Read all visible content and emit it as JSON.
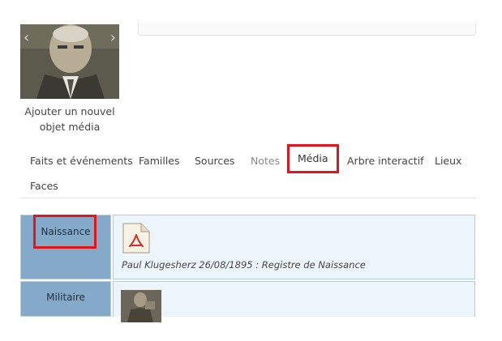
{
  "photo": {
    "prev_icon": "chevron-left-icon",
    "next_icon": "chevron-right-icon",
    "add_media_line1": "Ajouter un nouvel",
    "add_media_line2": "objet média"
  },
  "tabs": [
    {
      "label": "Faits et événements",
      "state": "normal"
    },
    {
      "label": "Familles",
      "state": "normal"
    },
    {
      "label": "Sources",
      "state": "normal"
    },
    {
      "label": "Notes",
      "state": "muted"
    },
    {
      "label": "Média",
      "state": "active"
    },
    {
      "label": "Arbre interactif",
      "state": "normal"
    },
    {
      "label": "Lieux",
      "state": "normal"
    },
    {
      "label": "Faces",
      "state": "normal"
    }
  ],
  "media_rows": [
    {
      "label": "Naissance",
      "icon": "pdf-file-icon",
      "caption": "Paul Klugesherz 26/08/1895 : Registre de Naissance"
    },
    {
      "label": "Militaire",
      "icon": "photo-thumbnail"
    }
  ],
  "colors": {
    "highlight": "#e0161b",
    "label_bg": "#85a9c9",
    "content_bg": "#edf5fc",
    "content_border": "#a9cfe7"
  }
}
